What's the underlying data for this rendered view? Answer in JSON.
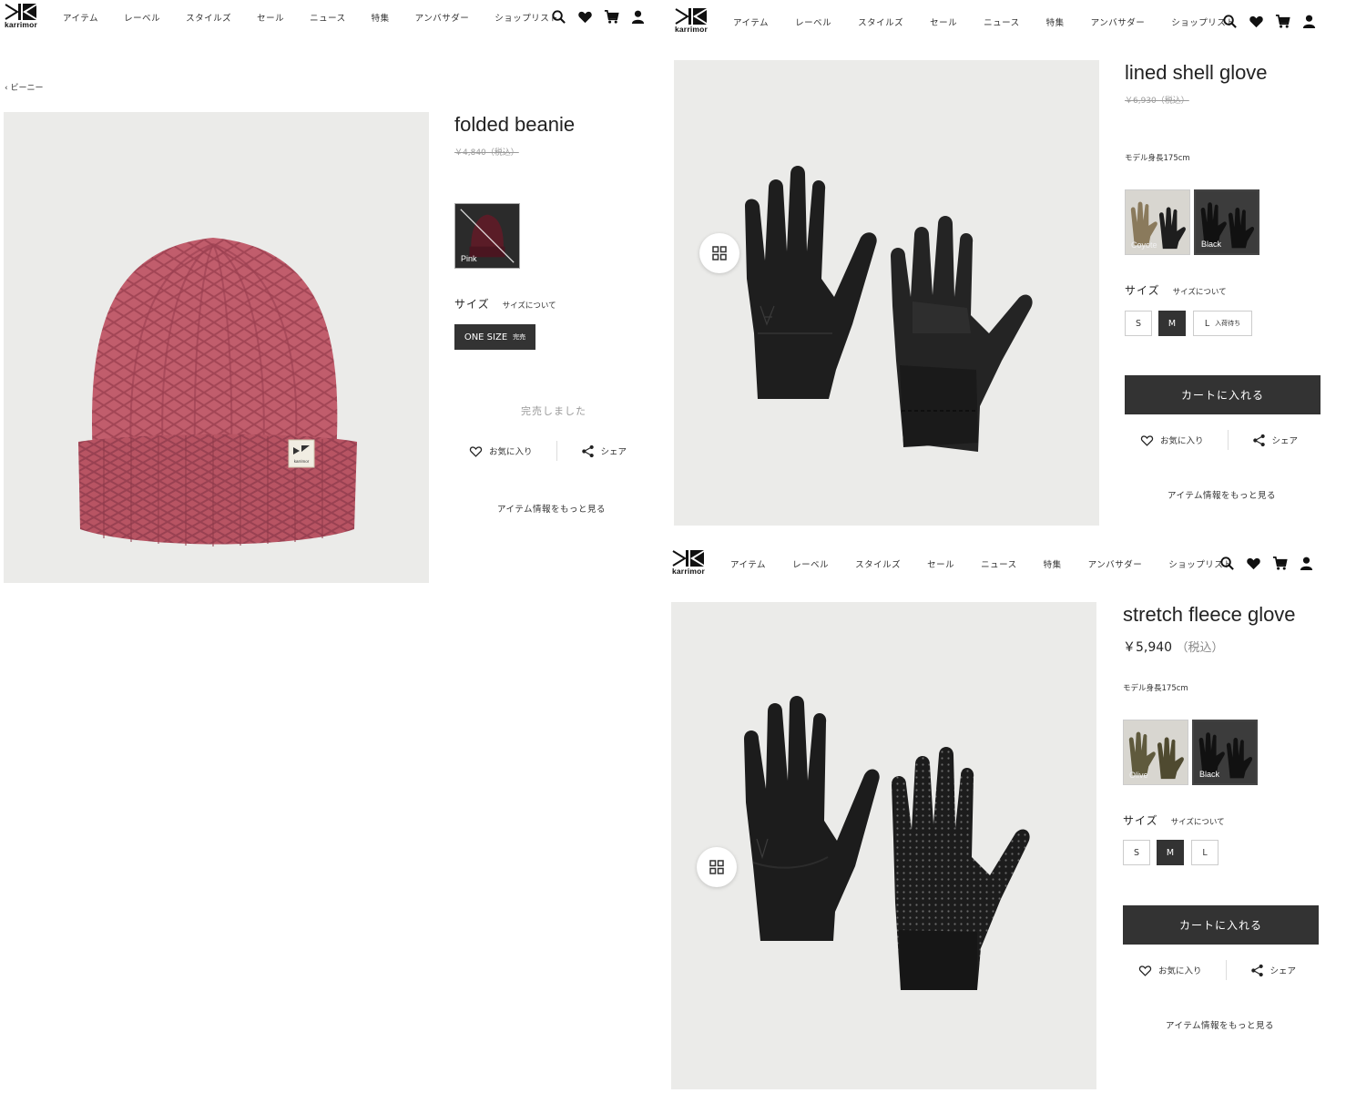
{
  "header": {
    "logo_text": "karrimor",
    "nav": [
      "アイテム",
      "レーベル",
      "スタイルズ",
      "セール",
      "ニュース",
      "特集",
      "アンバサダー",
      "ショップリスト"
    ],
    "icons": [
      "search-icon",
      "heart-icon",
      "cart-icon",
      "account-icon"
    ]
  },
  "beanie": {
    "breadcrumb": "ビーニー",
    "title": "folded beanie",
    "price_old": "￥4,840（税込）",
    "swatches": [
      {
        "label": "Pink",
        "color": "#5a1c27",
        "sold_out": true
      }
    ],
    "size_heading": "サイズ",
    "size_guide": "サイズについて",
    "sizes": [
      {
        "label": "ONE SIZE",
        "note": "完売",
        "selected": true
      }
    ],
    "soldout_text": "完売しました",
    "favorite_label": "お気に入り",
    "share_label": "シェア",
    "more_info": "アイテム情報をもっと見る",
    "logo_tag": "karrimor",
    "product_color": "#c15d6c"
  },
  "lined": {
    "title": "lined shell glove",
    "price_old": "￥6,930（税込）",
    "model_note": "モデル身長175cm",
    "swatches": [
      {
        "label": "Coyote",
        "color": "#8a7a5c",
        "selected": false
      },
      {
        "label": "Black",
        "color": "#1c1c1c",
        "selected": true
      }
    ],
    "size_heading": "サイズ",
    "size_guide": "サイズについて",
    "sizes": [
      {
        "label": "S",
        "note": "",
        "selected": false
      },
      {
        "label": "M",
        "note": "",
        "selected": true
      },
      {
        "label": "L",
        "note": "入荷待ち",
        "selected": false
      }
    ],
    "cart_label": "カートに入れる",
    "favorite_label": "お気に入り",
    "share_label": "シェア",
    "more_info": "アイテム情報をもっと見る"
  },
  "fleece": {
    "title": "stretch fleece glove",
    "price": "￥5,940",
    "price_tax": "（税込）",
    "model_note": "モデル身長175cm",
    "swatches": [
      {
        "label": "Olive",
        "color": "#5f5a3d",
        "selected": false
      },
      {
        "label": "Black",
        "color": "#1c1c1c",
        "selected": true
      }
    ],
    "size_heading": "サイズ",
    "size_guide": "サイズについて",
    "sizes": [
      {
        "label": "S",
        "note": "",
        "selected": false
      },
      {
        "label": "M",
        "note": "",
        "selected": true
      },
      {
        "label": "L",
        "note": "",
        "selected": false
      }
    ],
    "cart_label": "カートに入れる",
    "favorite_label": "お気に入り",
    "share_label": "シェア",
    "more_info": "アイテム情報をもっと見る"
  }
}
